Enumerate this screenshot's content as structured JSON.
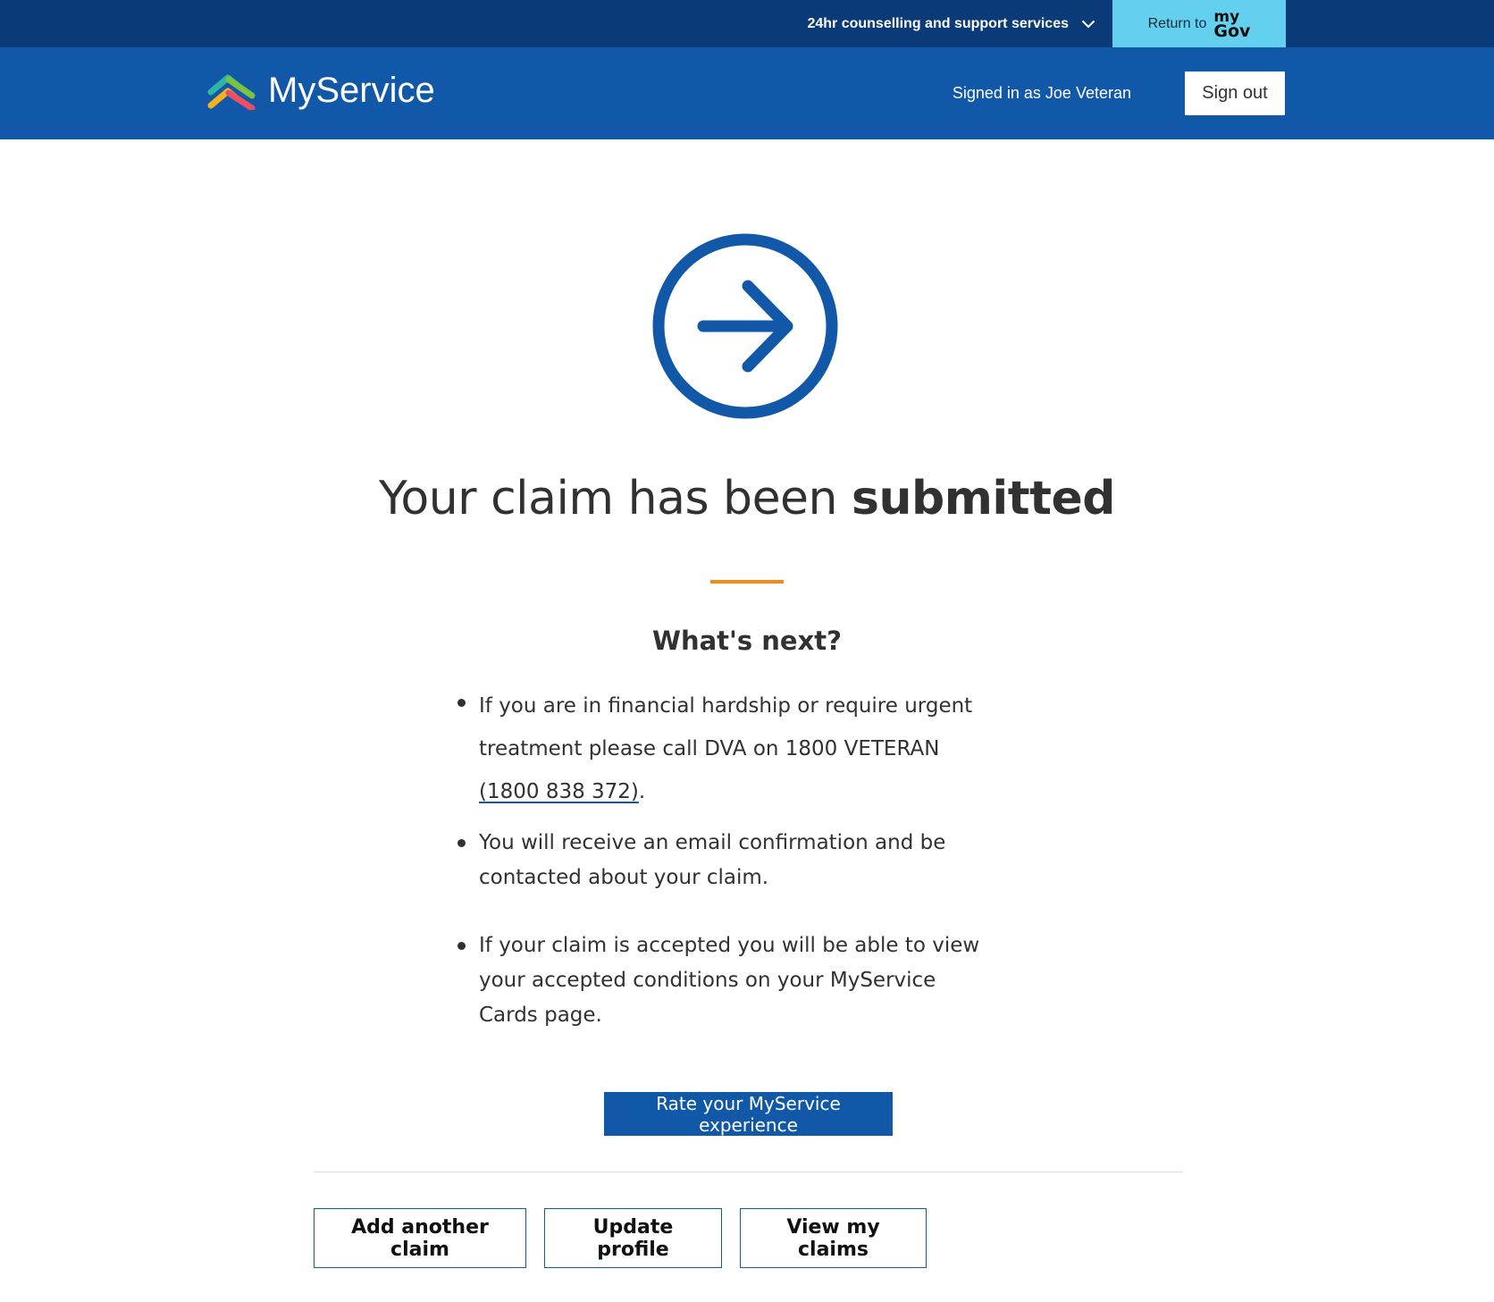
{
  "topbar": {
    "support_label": "24hr counselling and support services",
    "mygov_return": "Return to",
    "mygov_logo_top": "my",
    "mygov_logo_bottom": "Gov"
  },
  "header": {
    "brand": "MyService",
    "signed_in_text": "Signed in as Joe Veteran",
    "sign_out_label": "Sign out"
  },
  "main": {
    "icon": "arrow-right-circle-icon",
    "title_prefix": "Your claim has been ",
    "title_emphasis": "submitted",
    "subtitle": "What's next?",
    "items": [
      {
        "text_before": "If you are in financial hardship or require urgent treatment please call DVA on 1800 VETERAN ",
        "link_text": "(1800 838 372)",
        "text_after": "."
      },
      {
        "text": "You will receive an email confirmation and be contacted about your claim."
      },
      {
        "text": "If your claim is accepted you will be able to view your accepted conditions on your MyService Cards page."
      }
    ],
    "rate_label": "Rate your MyService experience"
  },
  "actions": {
    "add_claim": "Add another claim",
    "update_profile": "Update profile",
    "view_claims": "View my claims"
  },
  "colors": {
    "topbar": "#0b3a78",
    "header": "#1158a8",
    "mygov": "#62d0ee",
    "accent": "#f08a1a",
    "primary": "#1158a8"
  }
}
